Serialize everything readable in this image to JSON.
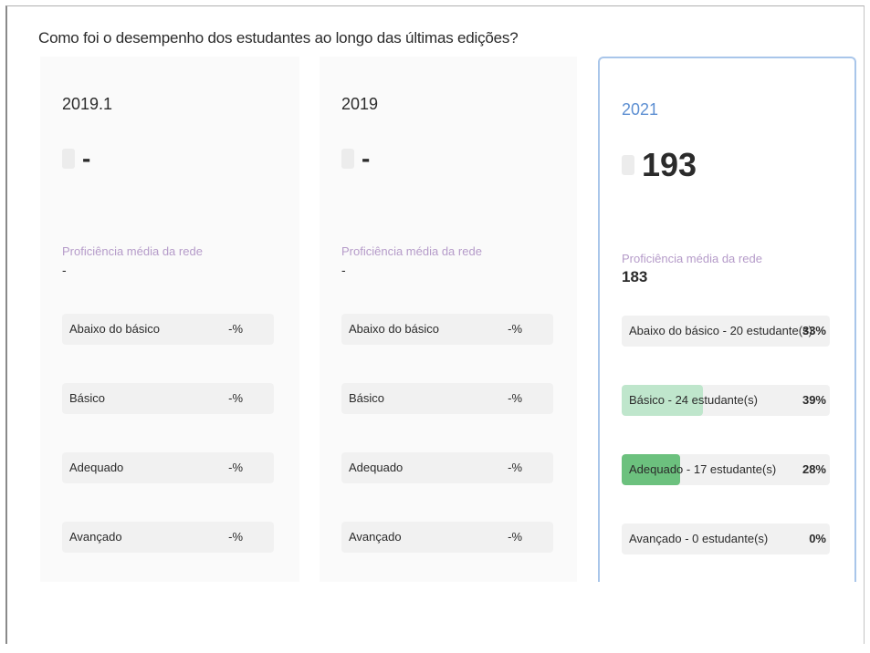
{
  "heading": "Como foi o desempenho dos estudantes ao longo das últimas edições?",
  "colors": {
    "basico_fill": "#bfe6cc",
    "adequado_fill": "#6cc17e",
    "highlight_border": "#a9c6ea",
    "year_highlight": "#5d8fd2"
  },
  "editions": [
    {
      "year": "2019.1",
      "score": "-",
      "proficiency_label": "Proficiência média da rede",
      "proficiency_value": "-",
      "levels": [
        {
          "name": "Abaixo do básico",
          "pct": "-%"
        },
        {
          "name": "Básico",
          "pct": "-%"
        },
        {
          "name": "Adequado",
          "pct": "-%"
        },
        {
          "name": "Avançado",
          "pct": "-%"
        }
      ]
    },
    {
      "year": "2019",
      "score": "-",
      "proficiency_label": "Proficiência média da rede",
      "proficiency_value": "-",
      "levels": [
        {
          "name": "Abaixo do básico",
          "pct": "-%"
        },
        {
          "name": "Básico",
          "pct": "-%"
        },
        {
          "name": "Adequado",
          "pct": "-%"
        },
        {
          "name": "Avançado",
          "pct": "-%"
        }
      ]
    },
    {
      "year": "2021",
      "score": "193",
      "proficiency_label": "Proficiência média da rede",
      "proficiency_value": "183",
      "levels": [
        {
          "name": "Abaixo do básico - 20 estudante(s)",
          "pct": "33%",
          "fill_fraction": 0
        },
        {
          "name": "Básico - 24 estudante(s)",
          "pct": "39%",
          "fill_fraction": 0.39
        },
        {
          "name": "Adequado - 17 estudante(s)",
          "pct": "28%",
          "fill_fraction": 0.28
        },
        {
          "name": "Avançado - 0 estudante(s)",
          "pct": "0%",
          "fill_fraction": 0
        }
      ]
    }
  ]
}
